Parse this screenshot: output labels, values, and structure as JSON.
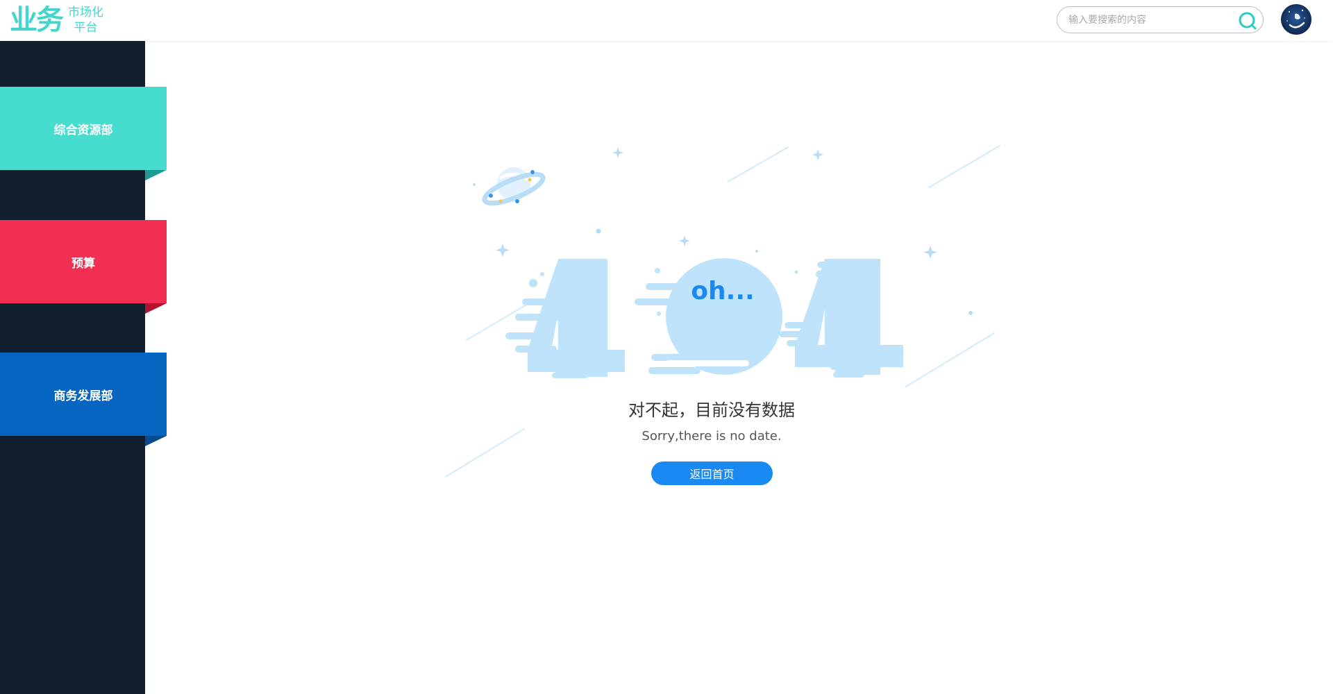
{
  "header": {
    "logo_main": "业务",
    "logo_sub_line1": "市场化",
    "logo_sub_line2": "平台",
    "search": {
      "placeholder": "输入要搜索的内容",
      "value": ""
    }
  },
  "sidebar": {
    "items": [
      {
        "label": "综合资源部",
        "color": "#46ddce"
      },
      {
        "label": "预算",
        "color": "#f22f52"
      },
      {
        "label": "商务发展部",
        "color": "#0565c0"
      }
    ]
  },
  "main": {
    "illustration_text": "oh...",
    "error_digits": "404",
    "message_cn": "对不起，目前没有数据",
    "message_en": "Sorry,there is no date.",
    "home_button": "返回首页"
  },
  "colors": {
    "accent": "#44d6ce",
    "sidebar_bg": "#121f2e",
    "button": "#1b89f2",
    "illustration": "#bfe3fb"
  },
  "icons": [
    "search-icon",
    "avatar",
    "planet-icon",
    "star-icon"
  ]
}
